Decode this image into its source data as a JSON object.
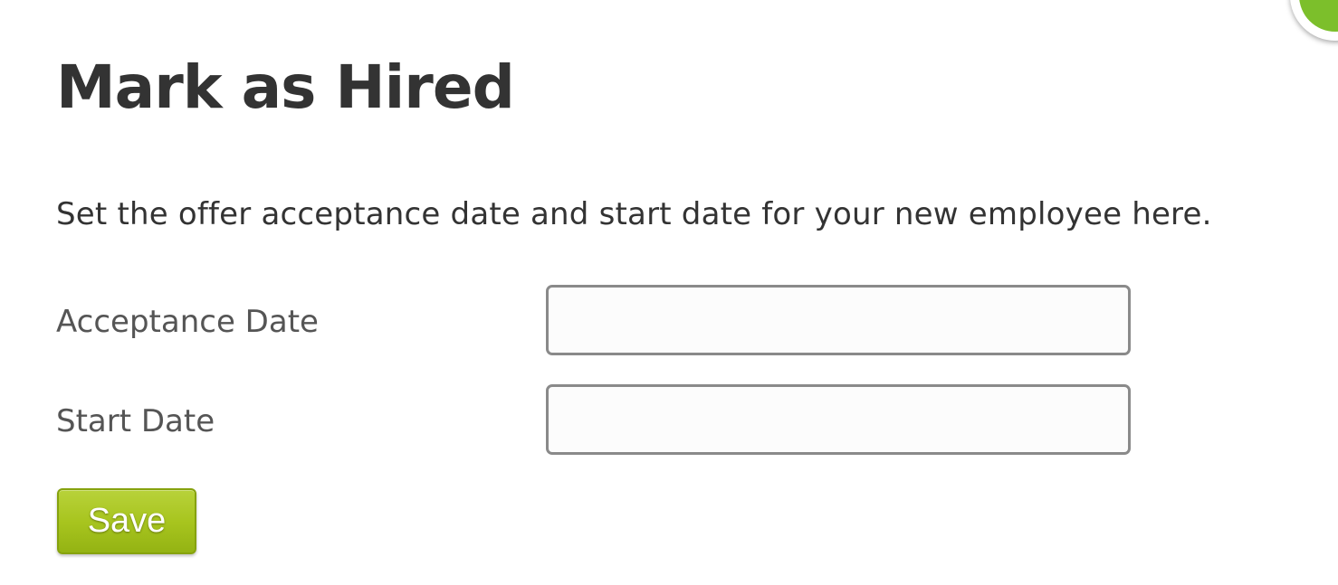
{
  "header": {
    "title": "Mark as Hired"
  },
  "intro": {
    "text": "Set the offer acceptance date and start date for your new employee here."
  },
  "form": {
    "acceptance_date": {
      "label": "Acceptance Date",
      "value": "",
      "placeholder": ""
    },
    "start_date": {
      "label": "Start Date",
      "value": "",
      "placeholder": ""
    },
    "save_label": "Save"
  },
  "colors": {
    "save_button": "#a8c51f",
    "chat_bubble": "#7cbf2b",
    "text": "#333333"
  },
  "icons": {
    "corner_widget": "chat-bubble-icon"
  }
}
